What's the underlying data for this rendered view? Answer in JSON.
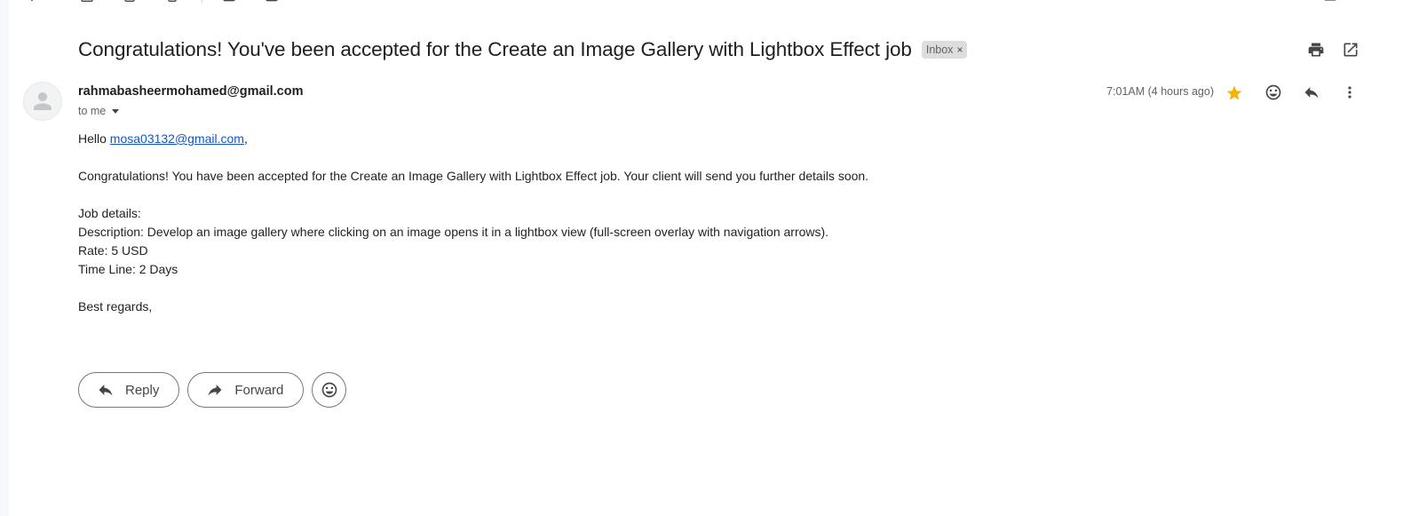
{
  "email": {
    "subject": "Congratulations! You've been accepted for the Create an Image Gallery with Lightbox Effect job",
    "label": "Inbox",
    "label_remove": "×",
    "sender": "rahmabasheermohamed@gmail.com",
    "recipient_text": "to me",
    "timestamp": "7:01AM (4 hours ago)",
    "starred": true,
    "star_color": "#f4b400",
    "body": {
      "greeting_prefix": "Hello ",
      "greeting_link": "mosa03132@gmail.com",
      "greeting_suffix": ",",
      "para1": "Congratulations! You have been accepted for the Create an Image Gallery with Lightbox Effect job. Your client will send you further details soon.",
      "job_heading": "Job details:",
      "description": "Description: Develop an image gallery where clicking on an image opens it in a lightbox view (full-screen overlay with navigation arrows).",
      "rate": "Rate: 5 USD",
      "timeline": "Time Line: 2 Days",
      "signoff": "Best regards,"
    }
  },
  "actions": {
    "reply": "Reply",
    "forward": "Forward"
  },
  "icons": {
    "print": "print-icon",
    "open_new_window": "open-in-new-window-icon",
    "star": "star-icon",
    "emoji": "emoji-reaction-icon",
    "reply": "reply-icon",
    "more": "more-vert-icon",
    "forward": "forward-icon",
    "avatar": "person-icon"
  }
}
